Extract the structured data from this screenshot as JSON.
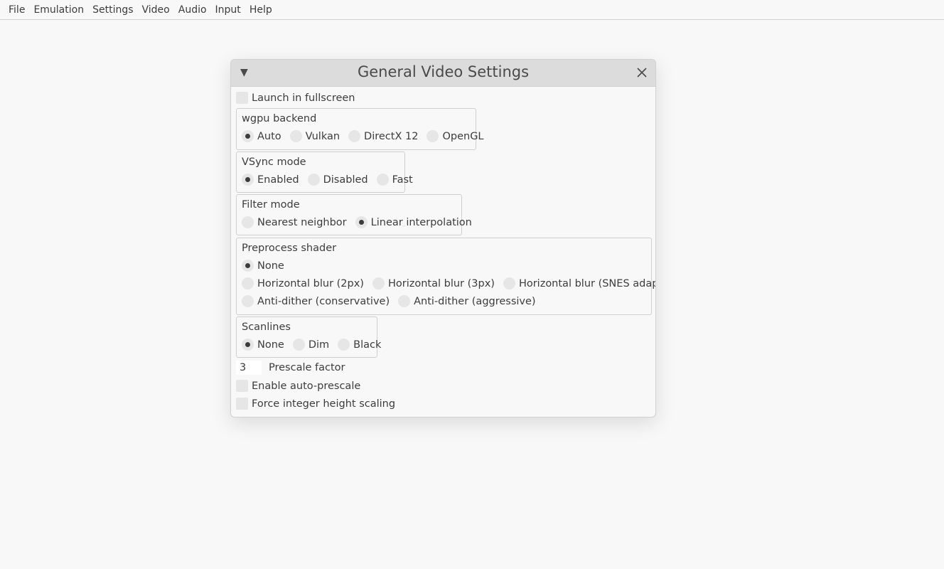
{
  "menubar": [
    "File",
    "Emulation",
    "Settings",
    "Video",
    "Audio",
    "Input",
    "Help"
  ],
  "window": {
    "title": "General Video Settings",
    "collapse_glyph": "▼",
    "launch_fullscreen": {
      "label": "Launch in fullscreen",
      "checked": false
    },
    "wgpu_backend": {
      "label": "wgpu backend",
      "options": [
        "Auto",
        "Vulkan",
        "DirectX 12",
        "OpenGL"
      ],
      "selected": "Auto"
    },
    "vsync_mode": {
      "label": "VSync mode",
      "options": [
        "Enabled",
        "Disabled",
        "Fast"
      ],
      "selected": "Enabled"
    },
    "filter_mode": {
      "label": "Filter mode",
      "options": [
        "Nearest neighbor",
        "Linear interpolation"
      ],
      "selected": "Linear interpolation"
    },
    "preprocess_shader": {
      "label": "Preprocess shader",
      "rows": [
        [
          "None"
        ],
        [
          "Horizontal blur (2px)",
          "Horizontal blur (3px)",
          "Horizontal blur (SNES adaptive)"
        ],
        [
          "Anti-dither (conservative)",
          "Anti-dither (aggressive)"
        ]
      ],
      "selected": "None"
    },
    "scanlines": {
      "label": "Scanlines",
      "options": [
        "None",
        "Dim",
        "Black"
      ],
      "selected": "None"
    },
    "prescale_factor": {
      "value": "3",
      "label": "Prescale factor"
    },
    "enable_auto_prescale": {
      "label": "Enable auto-prescale",
      "checked": false
    },
    "force_integer_height": {
      "label": "Force integer height scaling",
      "checked": false
    }
  },
  "icons": {
    "collapse": "triangle-down-icon",
    "close": "close-icon"
  }
}
